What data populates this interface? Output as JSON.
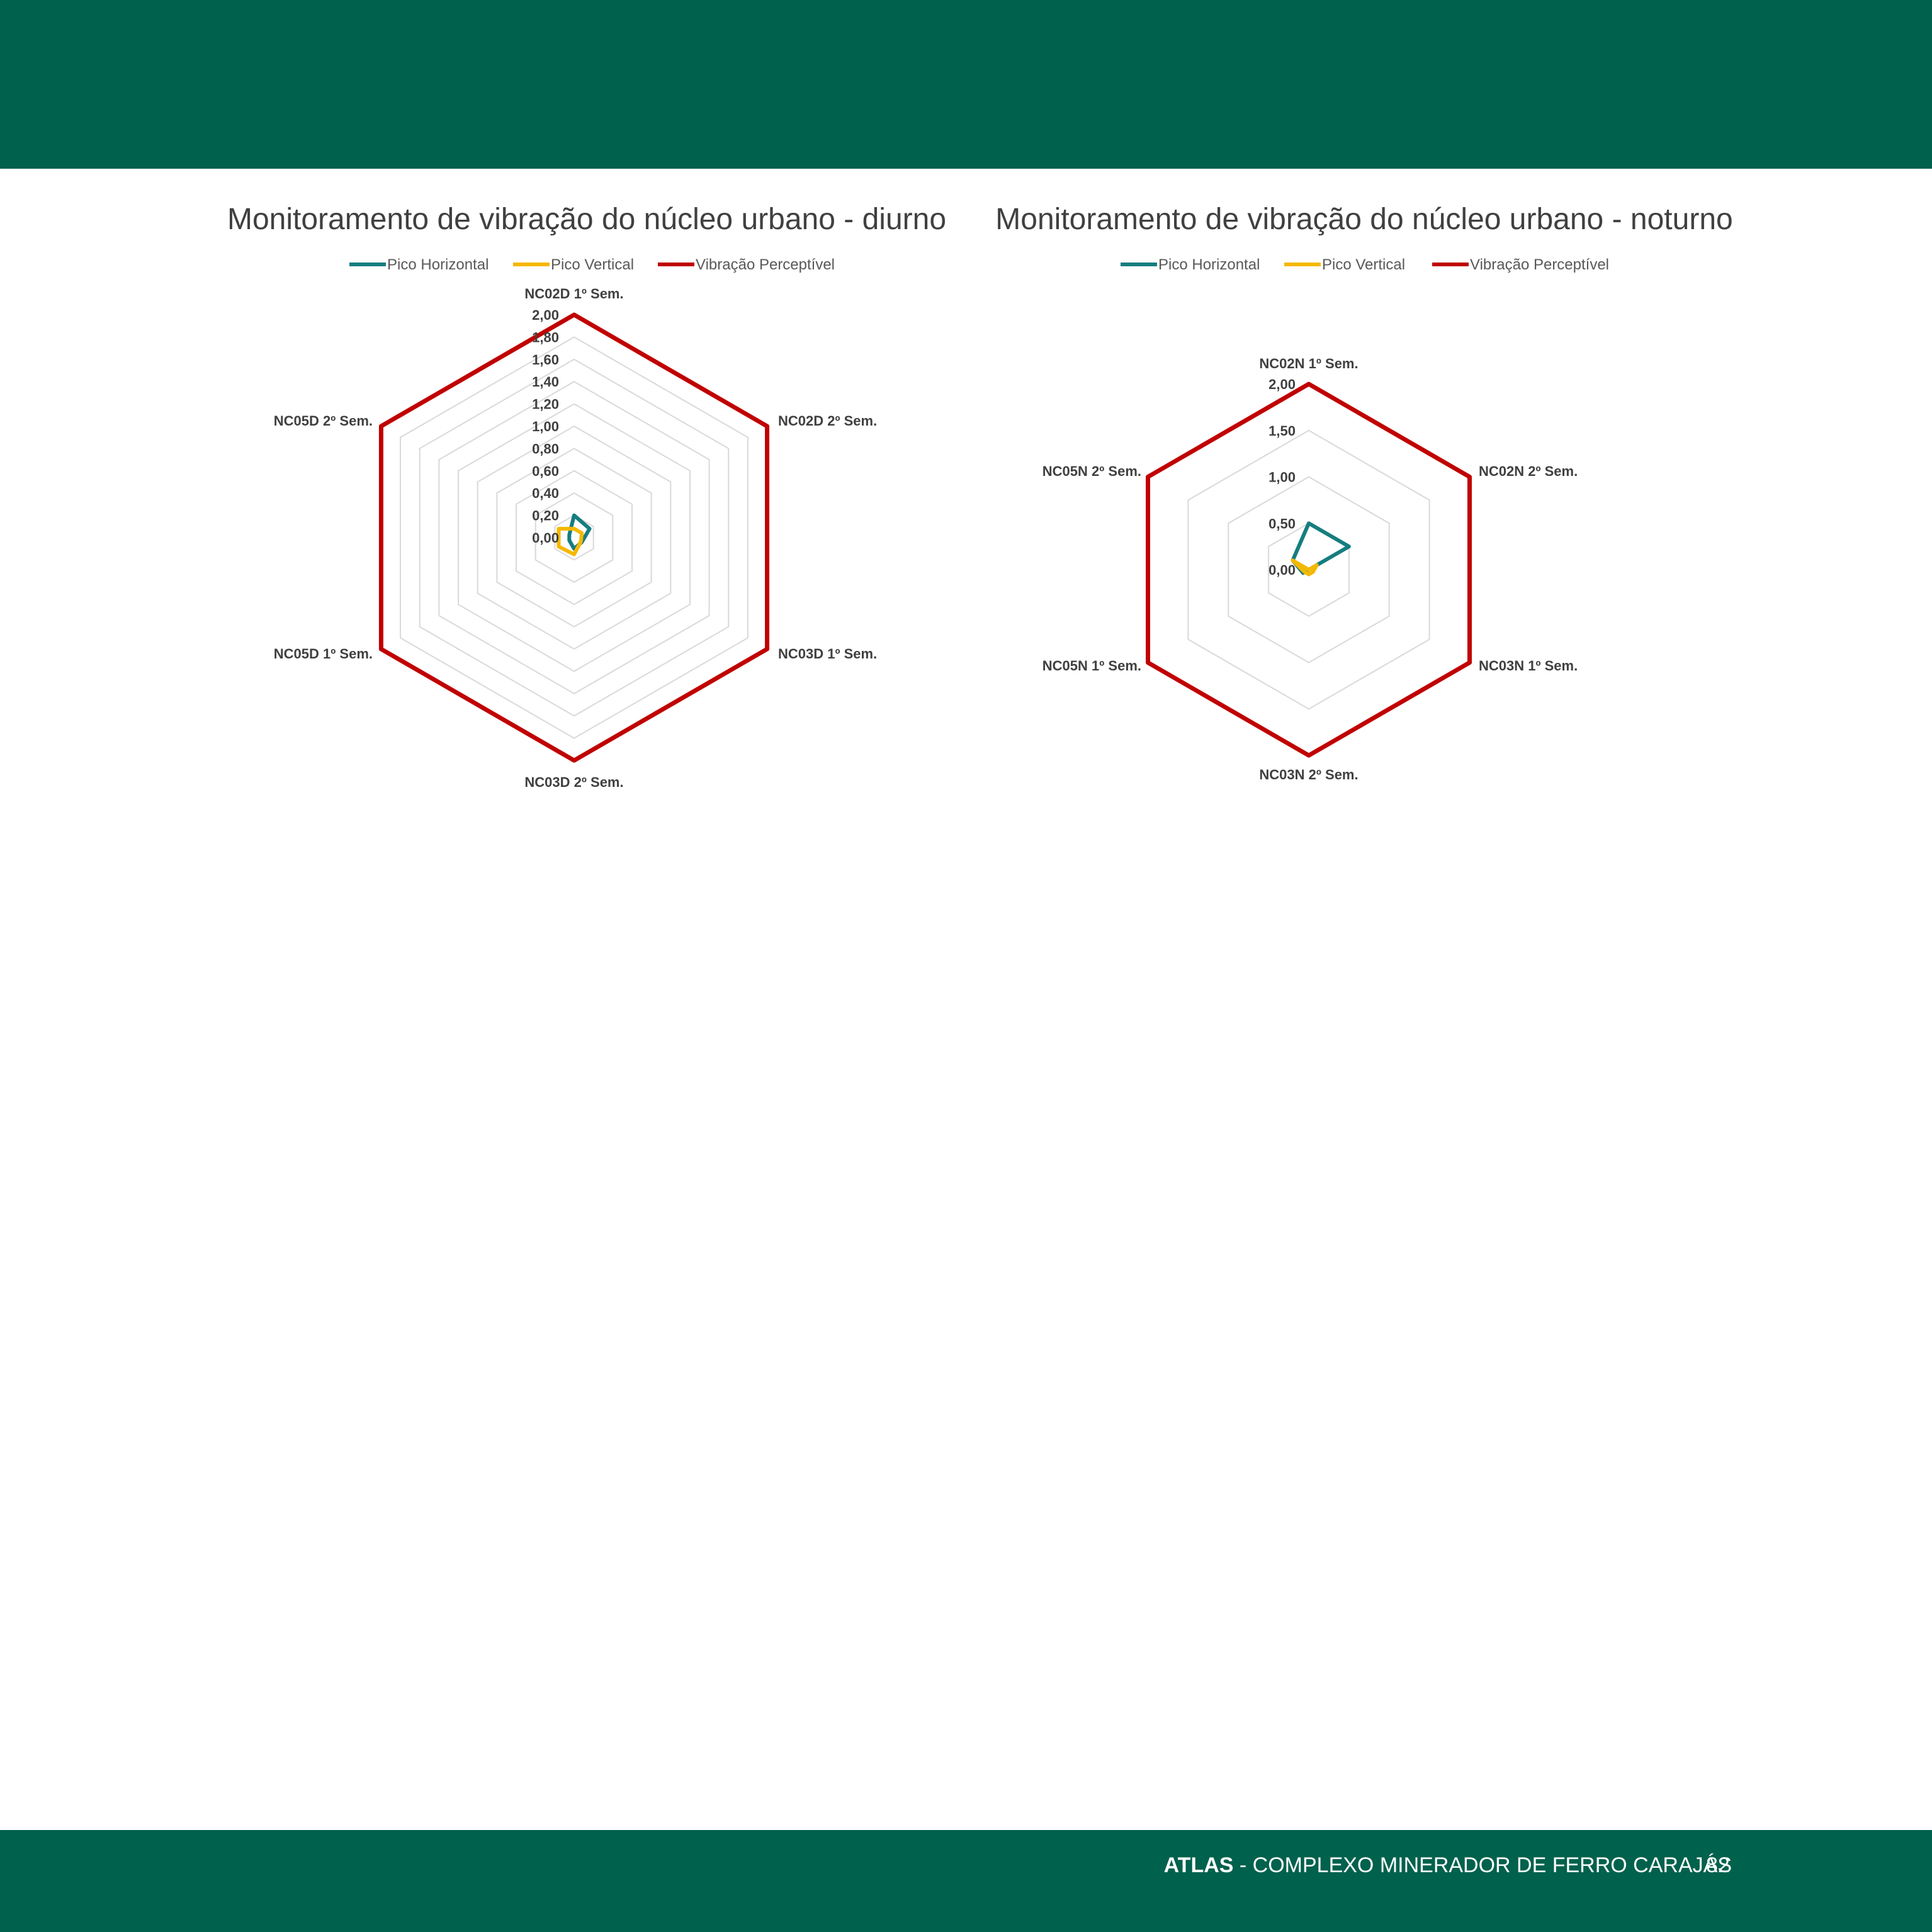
{
  "colors": {
    "brand_green": "#00614C",
    "pico_horizontal": "#167D7F",
    "pico_vertical": "#F5B800",
    "vibracao_perceptivel": "#C00000",
    "grid": "#D9D9D9"
  },
  "footer": {
    "brand": "ATLAS",
    "title": " - COMPLEXO MINERADOR DE FERRO CARAJÁS",
    "page": "82"
  },
  "legend": {
    "pico_horizontal": "Pico Horizontal",
    "pico_vertical": "Pico Vertical",
    "vibracao_perceptivel": "Vibração Perceptível"
  },
  "chart_data": [
    {
      "type": "radar",
      "title": "Monitoramento de vibração do núcleo urbano - diurno",
      "categories": [
        "NC02D 1º Sem.",
        "NC02D 2º Sem.",
        "NC03D 1º Sem.",
        "NC03D 2º Sem.",
        "NC05D 1º Sem.",
        "NC05D 2º Sem."
      ],
      "rlim": [
        0,
        2.0
      ],
      "ticks": [
        "0,00",
        "0,20",
        "0,40",
        "0,60",
        "0,80",
        "1,00",
        "1,20",
        "1,40",
        "1,60",
        "1,80",
        "2,00"
      ],
      "grid": true,
      "legend_position": "top",
      "series": [
        {
          "name": "Pico Horizontal",
          "values": [
            0.2,
            0.16,
            0.08,
            0.1,
            0.05,
            0.05
          ]
        },
        {
          "name": "Pico Vertical",
          "values": [
            0.08,
            0.08,
            0.07,
            0.15,
            0.16,
            0.16
          ]
        },
        {
          "name": "Vibração Perceptível",
          "values": [
            2.0,
            2.0,
            2.0,
            2.0,
            2.0,
            2.0
          ]
        }
      ]
    },
    {
      "type": "radar",
      "title": "Monitoramento de vibração do núcleo urbano - noturno",
      "categories": [
        "NC02N 1º Sem.",
        "NC02N 2º Sem.",
        "NC03N 1º Sem.",
        "NC03N 2º Sem.",
        "NC05N 1º Sem.",
        "NC05N 2º Sem."
      ],
      "rlim": [
        0,
        2.0
      ],
      "ticks": [
        "0,00",
        "0,50",
        "1,00",
        "1,50",
        "2,00"
      ],
      "grid": true,
      "legend_position": "top",
      "series": [
        {
          "name": "Pico Horizontal",
          "values": [
            0.5,
            0.5,
            0.0,
            0.0,
            0.07,
            0.2
          ]
        },
        {
          "name": "Pico Vertical",
          "values": [
            0.0,
            0.1,
            0.05,
            0.05,
            0.05,
            0.2
          ]
        },
        {
          "name": "Vibração Perceptível",
          "values": [
            2.0,
            2.0,
            2.0,
            2.0,
            2.0,
            2.0
          ]
        }
      ]
    }
  ]
}
